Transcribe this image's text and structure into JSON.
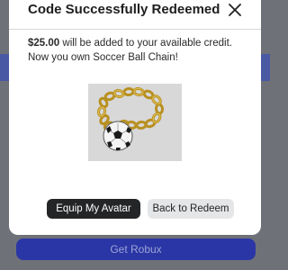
{
  "modal": {
    "title": "Code Successfully Redeemed",
    "message_amount": "$25.00",
    "message_rest": " will be added to your available credit.",
    "message_line2": "Now you own Soccer Ball Chain!",
    "equip_button_label": "Equip My Avatar",
    "back_button_label": "Back to Redeem",
    "close_icon": "close-icon",
    "item_image": "soccer-ball-chain-image"
  },
  "background": {
    "primary_button_label": "Get Robux"
  },
  "colors": {
    "overlay": "#6f7178",
    "modal_bg": "#ffffff",
    "primary_dark": "#232527",
    "secondary_button": "#e5e6e8",
    "get_robux_blue": "#2b36a6"
  }
}
